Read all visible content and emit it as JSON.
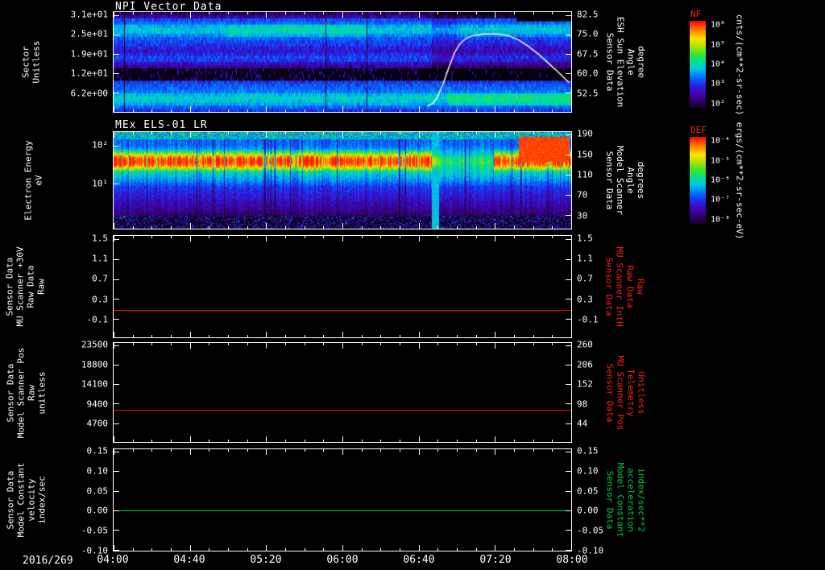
{
  "x_axis": {
    "date": "2016/269",
    "labels": [
      "04:00",
      "04:40",
      "05:20",
      "06:00",
      "06:40",
      "07:20",
      "08:00"
    ]
  },
  "chart_data": [
    {
      "type": "heatmap",
      "title": "NPI Vector Data",
      "ylabel_lines": [
        "Sector",
        "Unitless"
      ],
      "yticks": [
        "3.1e+01",
        "2.5e+01",
        "1.9e+01",
        "1.2e+01",
        "6.2e+00"
      ],
      "right_label_lines": [
        "Sensor Data",
        "ESH Sun Elevation",
        "Angle",
        "degree"
      ],
      "right_ticks": [
        "82.5",
        "75.0",
        "67.5",
        "60.0",
        "52.5"
      ],
      "colorbar": {
        "title": "NF",
        "ticks": [
          "10⁶",
          "10⁵",
          "10⁴",
          "10³",
          "10²"
        ],
        "units": "cnts/(cm**2-sr-sec)"
      },
      "overlay_line": {
        "name": "ESH Sun Elevation Angle",
        "color": "#ffffff",
        "points": [
          [
            0.685,
            47.5
          ],
          [
            0.698,
            48.5
          ],
          [
            0.708,
            51.0
          ],
          [
            0.72,
            56.0
          ],
          [
            0.732,
            62.0
          ],
          [
            0.745,
            68.0
          ],
          [
            0.757,
            71.5
          ],
          [
            0.77,
            73.5
          ],
          [
            0.785,
            74.6
          ],
          [
            0.81,
            75.2
          ],
          [
            0.84,
            75.2
          ],
          [
            0.862,
            74.6
          ],
          [
            0.884,
            73.0
          ],
          [
            0.906,
            70.5
          ],
          [
            0.928,
            67.5
          ],
          [
            0.95,
            64.0
          ],
          [
            0.972,
            60.5
          ],
          [
            0.995,
            56.5
          ]
        ]
      },
      "heatmap": {
        "rows": [
          0.1,
          0.16,
          0.3,
          0.34,
          0.42,
          0.46,
          0.44,
          0.38,
          0.33,
          0.3,
          0.28,
          0.24,
          0.22,
          0.26,
          0.3,
          0.28,
          0.2,
          0.16,
          0.05,
          0.04,
          0.05,
          0.06,
          0.28,
          0.32,
          0.34,
          0.36,
          0.44,
          0.48,
          0.46,
          0.42,
          0.34,
          0.28
        ],
        "patches": [
          [
            0.25,
            0.55,
            4,
            7,
            0.05
          ],
          [
            0.7,
            1.0,
            0,
            1,
            -0.08
          ],
          [
            0.88,
            1.0,
            0,
            2,
            -0.28
          ],
          [
            0.73,
            1.0,
            26,
            29,
            0.07
          ],
          [
            0.695,
            0.75,
            2,
            17,
            -0.07
          ],
          [
            0.75,
            1.0,
            8,
            17,
            -0.04
          ]
        ]
      }
    },
    {
      "type": "heatmap",
      "title": "MEx ELS-01 LR",
      "ylabel_lines": [
        "Electron Energy",
        "eV"
      ],
      "yticks": [
        "10²",
        "10¹"
      ],
      "right_label_lines": [
        "Sensor Data",
        "Model Scanner",
        "Angle",
        "degrees"
      ],
      "right_ticks": [
        "190",
        "150",
        "110",
        "70",
        "30"
      ],
      "colorbar": {
        "title": "DEF",
        "ticks": [
          "10⁻⁴",
          "10⁻⁵",
          "10⁻⁶",
          "10⁻⁷",
          "10⁻⁸"
        ],
        "units": "ergs/(cm**2-sr-sec-eV)"
      },
      "spec": {
        "core_center": 0.3,
        "core_width": 0.135,
        "core_peak": 0.97,
        "halo_center": 0.33,
        "halo_width": 0.3,
        "halo_peak": 0.52,
        "dim_x": [
          0.71,
          0.83
        ],
        "dim_factor": 0.6,
        "cyan_col": [
          0.695,
          0.71
        ],
        "red_blob": {
          "x": [
            0.885,
            0.995
          ],
          "y": [
            0.05,
            0.3
          ]
        }
      }
    },
    {
      "type": "line",
      "ylabel_lines": [
        "Sensor Data",
        "MU Scanner +30V",
        "Raw Data",
        "Raw"
      ],
      "yticks": [
        "1.5",
        "1.1",
        "0.7",
        "0.3",
        "-0.1"
      ],
      "right_label_lines": [
        "Sensor Data",
        "MU Scanner IntH",
        "Raw Data",
        "Raw"
      ],
      "right_ticks": [
        "1.5",
        "1.1",
        "0.7",
        "0.3",
        "-0.1"
      ],
      "series": [
        {
          "name": "MU Scanner +30V Raw Data",
          "color": "#ff0000",
          "value": 0.08
        }
      ]
    },
    {
      "type": "line",
      "ylabel_lines": [
        "Sensor Data",
        "Model Scanner Pos",
        "Raw",
        "unitless"
      ],
      "yticks": [
        "23500",
        "18800",
        "14100",
        "9400",
        "4700"
      ],
      "right_label_lines": [
        "Sensor Data",
        "MU Scanner Pos",
        "Telemetry",
        "Unitless"
      ],
      "right_ticks": [
        "260",
        "206",
        "152",
        "98",
        "44"
      ],
      "series": [
        {
          "name": "Model Scanner Pos Raw",
          "color": "#ff0000",
          "value": 8000
        }
      ]
    },
    {
      "type": "line",
      "ylabel_lines": [
        "Sensor Data",
        "Model Constant",
        "velocity",
        "index/sec"
      ],
      "yticks": [
        "0.15",
        "0.10",
        "0.05",
        "0.00",
        "-0.05",
        "-0.10"
      ],
      "right_label_lines": [
        "Sensor Data",
        "Model Constant",
        "acceleration",
        "index/sec**2"
      ],
      "right_ticks": [
        "0.15",
        "0.10",
        "0.05",
        "0.00",
        "-0.05",
        "-0.10"
      ],
      "series": [
        {
          "name": "Model Constant velocity",
          "color": "#00cc44",
          "value": 0.0
        }
      ]
    }
  ]
}
